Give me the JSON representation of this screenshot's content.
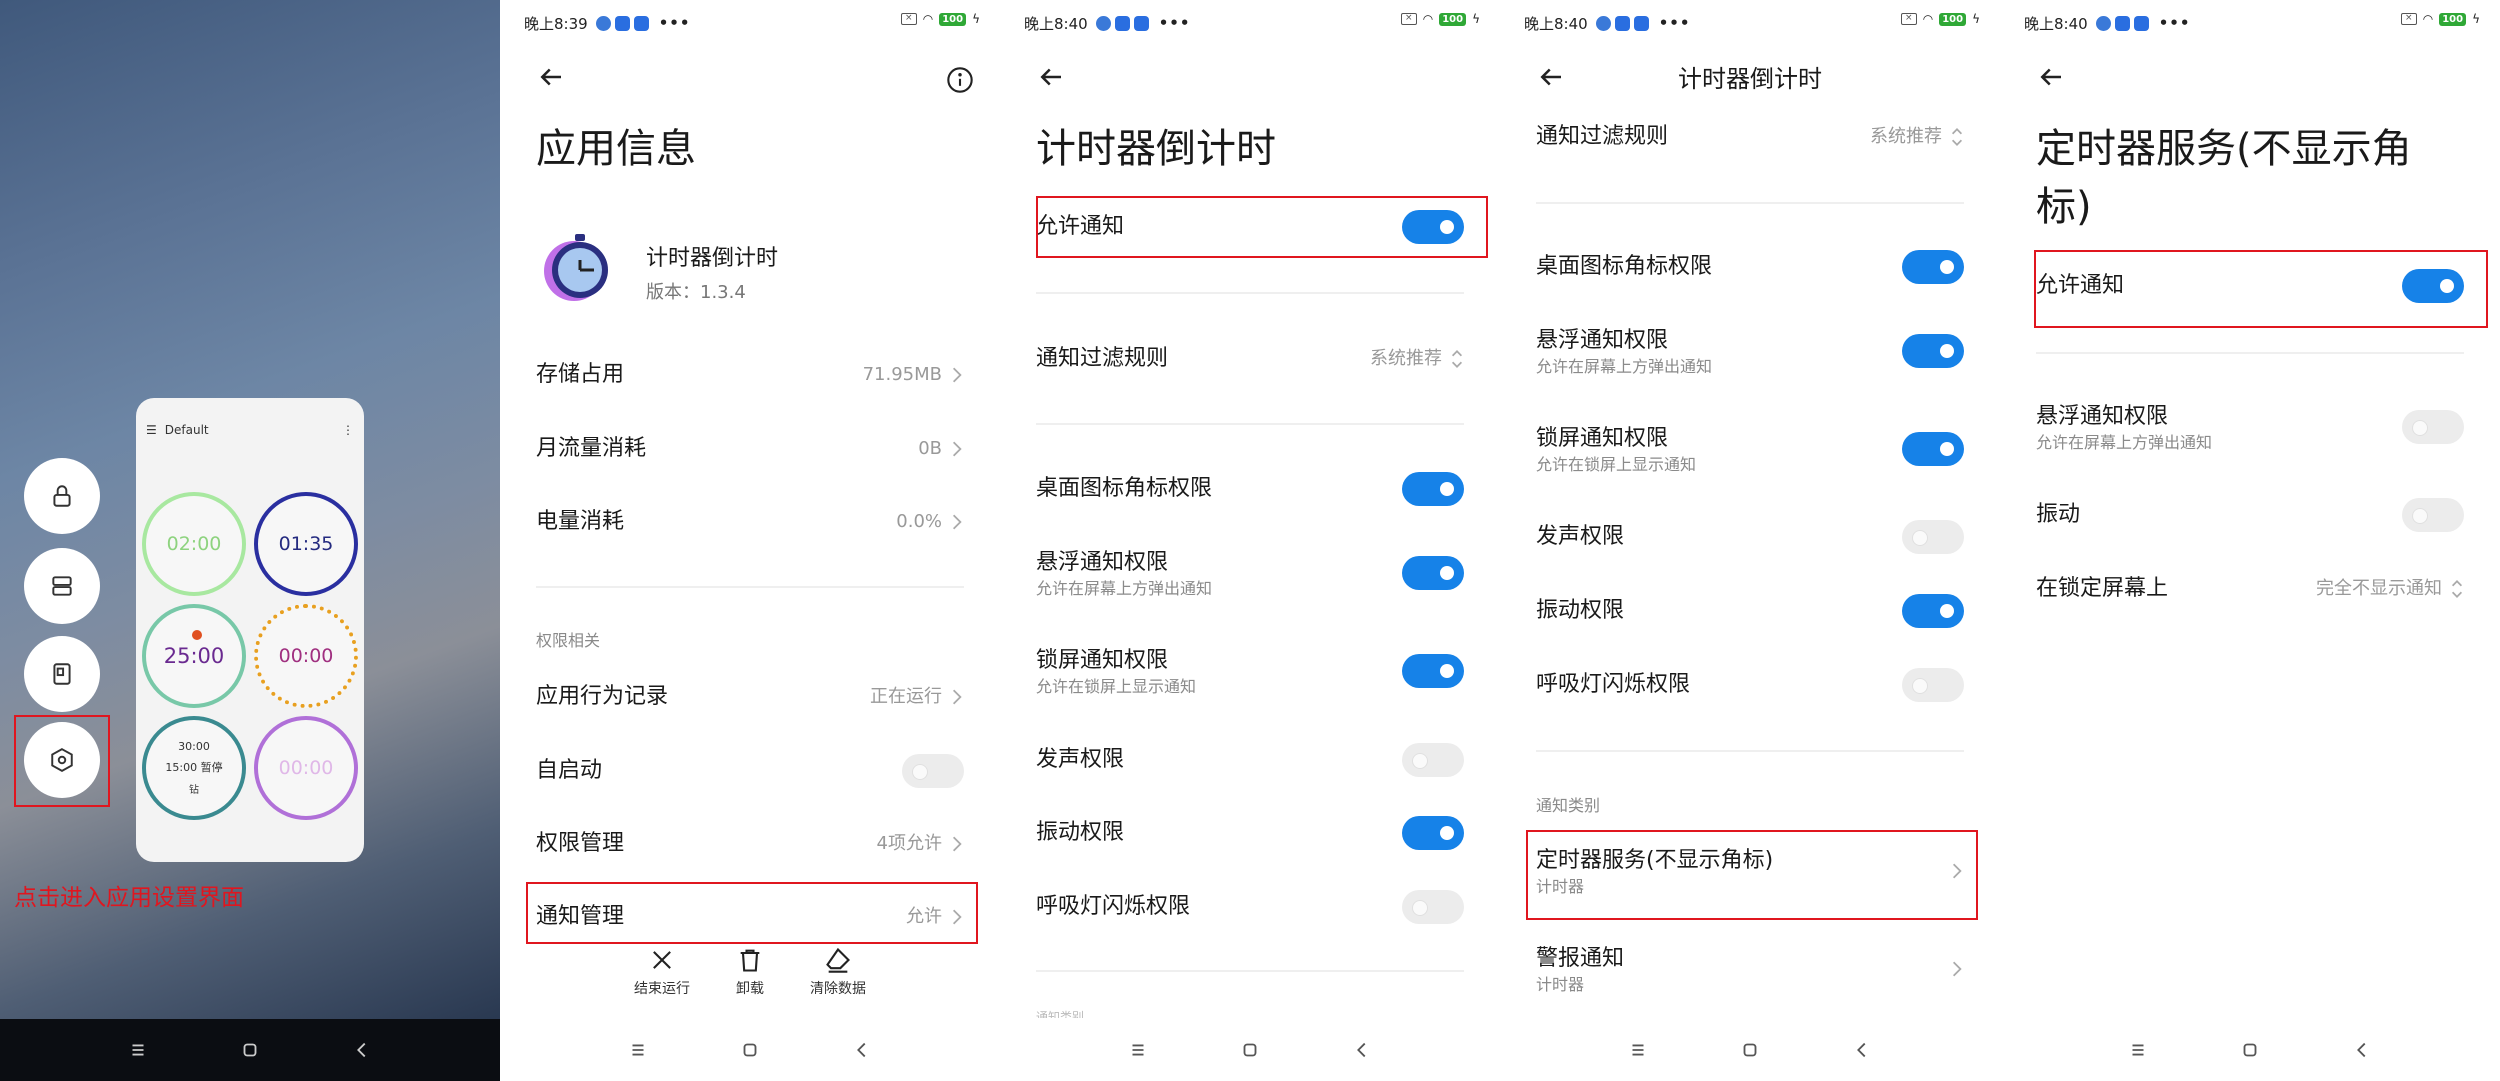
{
  "panel0": {
    "card_title": "Default",
    "clocks": [
      "02:00",
      "01:35",
      "25:00",
      "00:00",
      "30:00",
      "00:00"
    ],
    "clock5_line2": "15:00 暂停",
    "clock5_line3": "钻",
    "hint": "点击进入应用设置界面"
  },
  "panel1": {
    "time": "晚上8:39",
    "battery": "100",
    "title": "应用信息",
    "app_name": "计时器倒计时",
    "version": "版本：1.3.4",
    "rows": {
      "storage": {
        "label": "存储占用",
        "value": "71.95MB"
      },
      "traffic": {
        "label": "月流量消耗",
        "value": "0B"
      },
      "power": {
        "label": "电量消耗",
        "value": "0.0%"
      },
      "section": "权限相关",
      "behavior": {
        "label": "应用行为记录",
        "value": "正在运行"
      },
      "autostart": {
        "label": "自启动"
      },
      "perm": {
        "label": "权限管理",
        "value": "4项允许"
      },
      "notify": {
        "label": "通知管理",
        "value": "允许"
      }
    },
    "actions": [
      "结束运行",
      "卸载",
      "清除数据"
    ]
  },
  "panel2": {
    "time": "晚上8:40",
    "battery": "100",
    "title": "计时器倒计时",
    "allow_notify": "允许通知",
    "filter": {
      "label": "通知过滤规则",
      "value": "系统推荐"
    },
    "badge": "桌面图标角标权限",
    "float": {
      "label": "悬浮通知权限",
      "sub": "允许在屏幕上方弹出通知"
    },
    "lock": {
      "label": "锁屏通知权限",
      "sub": "允许在锁屏上显示通知"
    },
    "sound": "发声权限",
    "vibrate": "振动权限",
    "led": "呼吸灯闪烁权限",
    "cut_text": "通知类别"
  },
  "panel3": {
    "time": "晚上8:40",
    "battery": "100",
    "title": "计时器倒计时",
    "filter": {
      "label": "通知过滤规则",
      "value": "系统推荐"
    },
    "badge": "桌面图标角标权限",
    "float": {
      "label": "悬浮通知权限",
      "sub": "允许在屏幕上方弹出通知"
    },
    "lock": {
      "label": "锁屏通知权限",
      "sub": "允许在锁屏上显示通知"
    },
    "sound": "发声权限",
    "vibrate": "振动权限",
    "led": "呼吸灯闪烁权限",
    "section": "通知类别",
    "cat1": {
      "label": "定时器服务(不显示角标)",
      "sub": "计时器"
    },
    "cat2": {
      "label": "警报通知",
      "sub": "计时器"
    }
  },
  "panel4": {
    "time": "晚上8:40",
    "battery": "100",
    "title_line1": "定时器服务(不显示角",
    "title_line2": "标)",
    "allow_notify": "允许通知",
    "float": {
      "label": "悬浮通知权限",
      "sub": "允许在屏幕上方弹出通知"
    },
    "vibrate": "振动",
    "lockscreen": {
      "label": "在锁定屏幕上",
      "value": "完全不显示通知"
    }
  },
  "colors": {
    "accent": "#1682e8",
    "highlight": "#e0161f"
  }
}
